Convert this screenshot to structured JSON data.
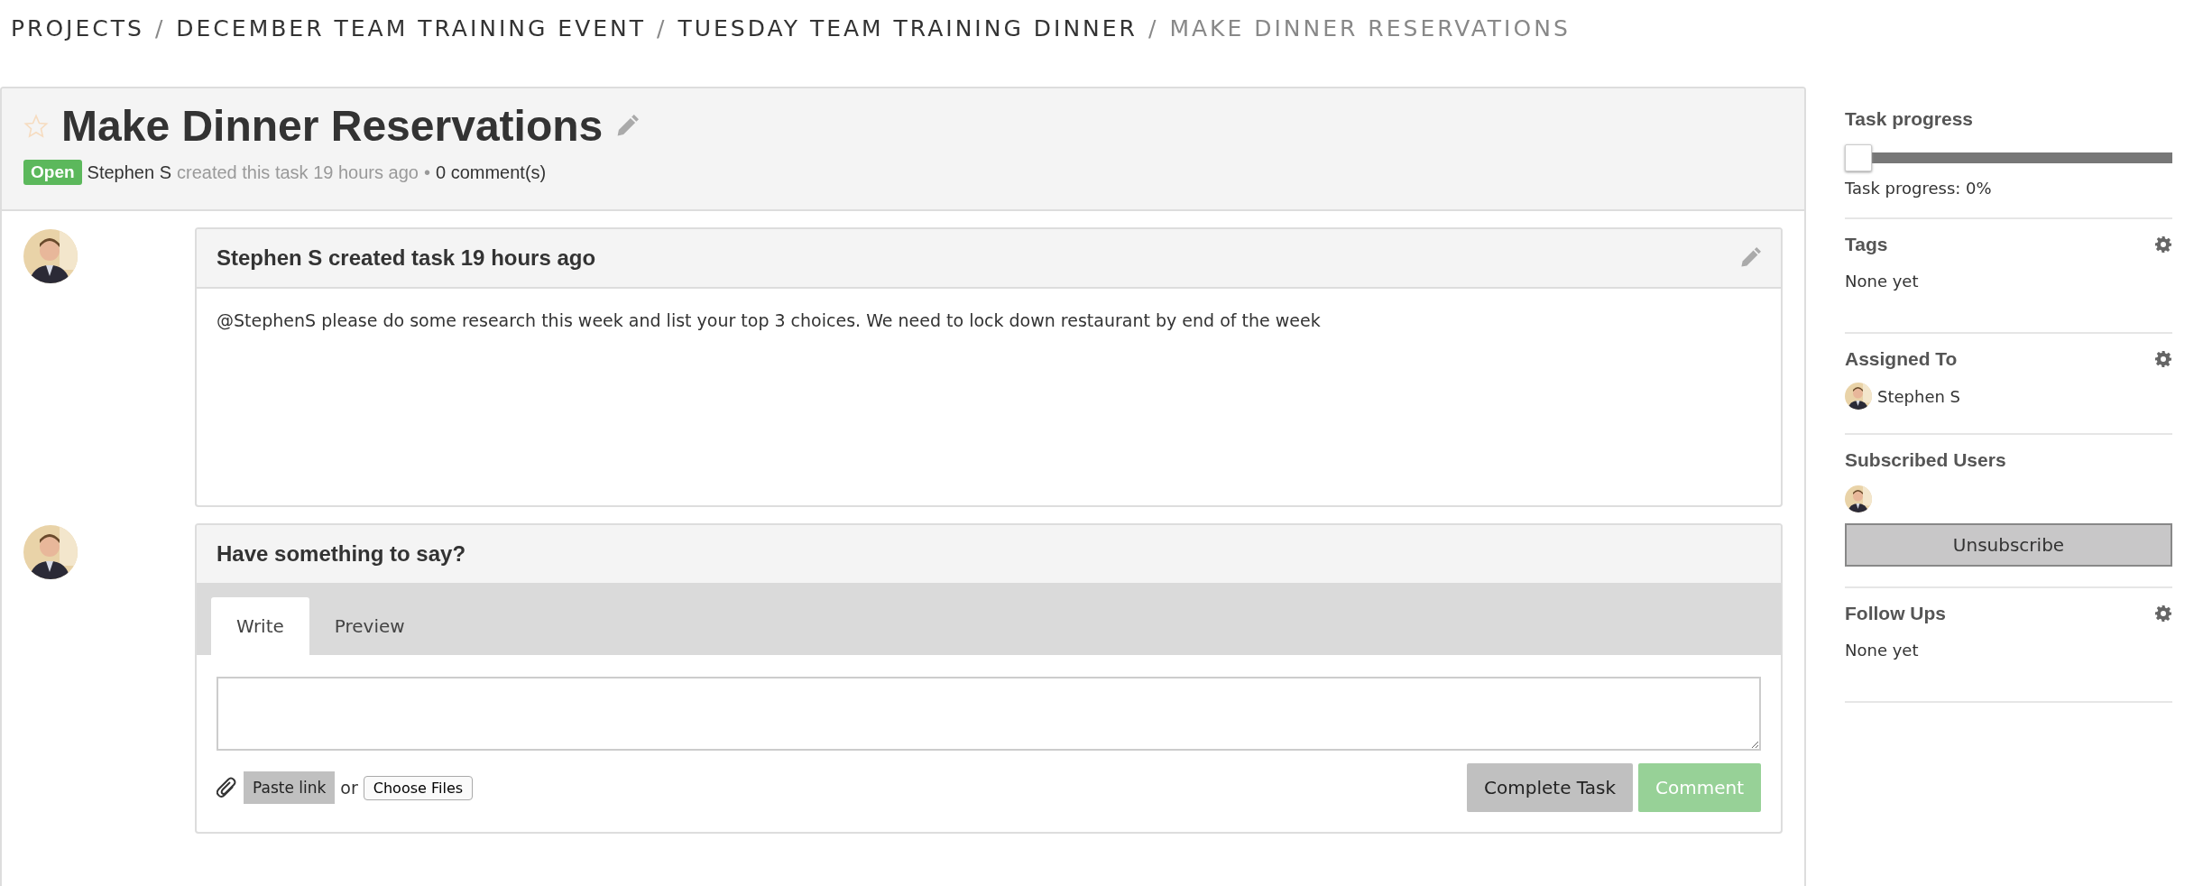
{
  "breadcrumb": [
    {
      "label": "PROJECTS",
      "current": false
    },
    {
      "label": "DECEMBER TEAM TRAINING EVENT",
      "current": false
    },
    {
      "label": "TUESDAY TEAM TRAINING DINNER",
      "current": false
    },
    {
      "label": "MAKE DINNER RESERVATIONS",
      "current": true
    }
  ],
  "breadcrumb_separator": "/",
  "task": {
    "title": "Make Dinner Reservations",
    "starred": false,
    "status": "Open",
    "author": "Stephen S",
    "created": "created this task 19 hours ago",
    "separator": "•",
    "comments": "0 comment(s)"
  },
  "posts": [
    {
      "heading": "Stephen S created task 19 hours ago",
      "body": "@StephenS please do some research this week and list your top 3 choices. We need to lock down restaurant by end of the week"
    }
  ],
  "composer": {
    "heading": "Have something to say?",
    "tabs": [
      {
        "label": "Write",
        "selected": true
      },
      {
        "label": "Preview",
        "selected": false
      }
    ],
    "paste_link": "Paste link",
    "or": "or",
    "choose_files": "Choose Files",
    "buttons": [
      {
        "label": "Complete Task",
        "kind": "secondary",
        "disabled": false
      },
      {
        "label": "Comment",
        "kind": "primary",
        "disabled": true
      }
    ]
  },
  "sidebar": {
    "progress": {
      "title": "Task progress",
      "level": 0,
      "reading": "Task progress: 0%"
    },
    "sections": [
      {
        "kind": "text",
        "title": "Tags",
        "settings": true,
        "text": "None yet"
      },
      {
        "kind": "user",
        "title": "Assigned To",
        "settings": true,
        "user": "Stephen S"
      },
      {
        "kind": "subscribers",
        "title": "Subscribed Users",
        "settings": false,
        "button": "Unsubscribe"
      },
      {
        "kind": "text",
        "title": "Follow Ups",
        "settings": true,
        "text": "None yet"
      }
    ]
  }
}
